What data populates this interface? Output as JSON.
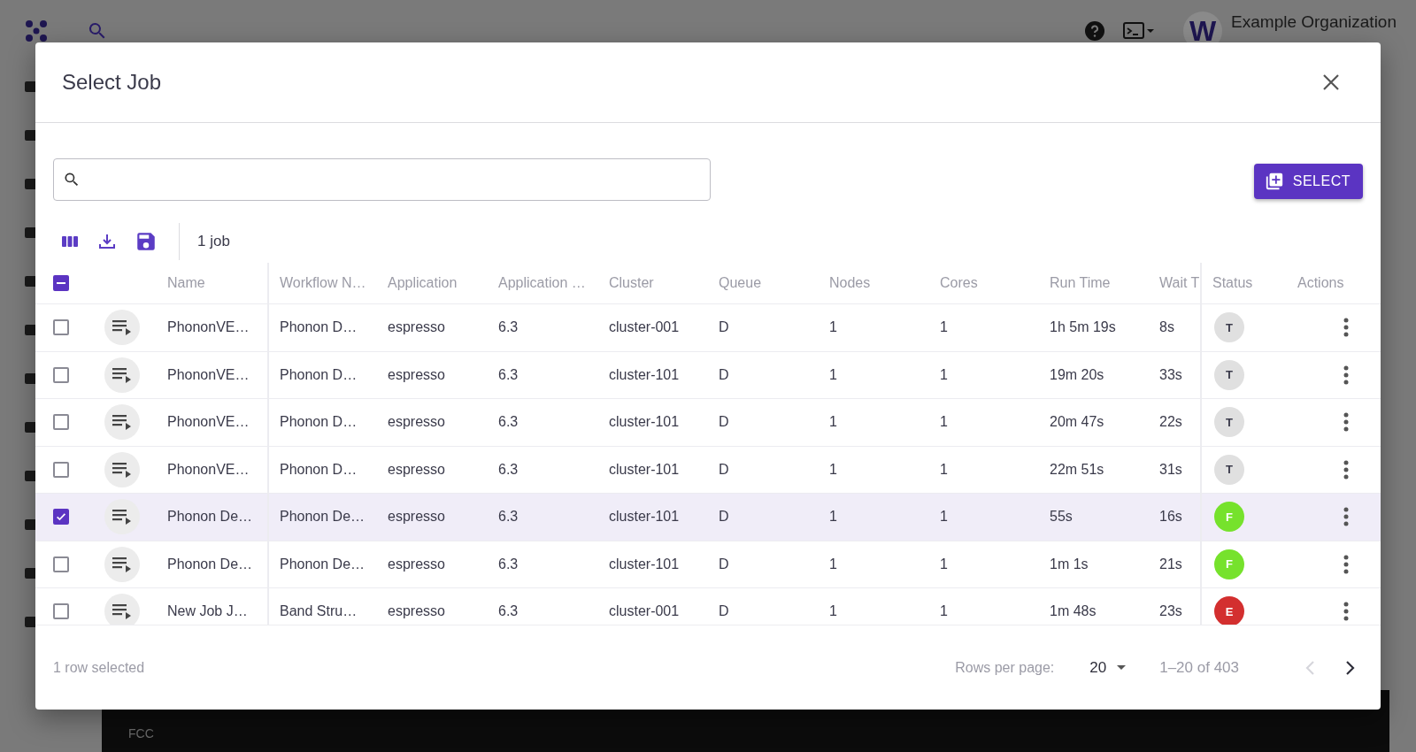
{
  "app": {
    "avatar_letter": "W",
    "org_name": "Example Organization",
    "panel_subtitle": "FCC"
  },
  "dialog": {
    "title": "Select Job",
    "select_button": "SELECT",
    "job_count": "1 job",
    "table": {
      "select_all": {
        "indeterminate": true
      },
      "columns": [
        "Name",
        "Workflow N…",
        "Application",
        "Application …",
        "Cluster",
        "Queue",
        "Nodes",
        "Cores",
        "Run Time",
        "Wait T",
        "Status",
        "Actions"
      ],
      "rows": [
        {
          "selected": false,
          "cells": [
            "PhononVE…",
            "Phonon D…",
            "espresso",
            "6.3",
            "cluster-001",
            "D",
            "1",
            "1",
            "1h 5m 19s",
            "8s"
          ],
          "status": {
            "label": "T",
            "color": "#e0e0e0"
          }
        },
        {
          "selected": false,
          "cells": [
            "PhononVE…",
            "Phonon D…",
            "espresso",
            "6.3",
            "cluster-101",
            "D",
            "1",
            "1",
            "19m 20s",
            "33s"
          ],
          "status": {
            "label": "T",
            "color": "#e0e0e0"
          }
        },
        {
          "selected": false,
          "cells": [
            "PhononVE…",
            "Phonon D…",
            "espresso",
            "6.3",
            "cluster-101",
            "D",
            "1",
            "1",
            "20m 47s",
            "22s"
          ],
          "status": {
            "label": "T",
            "color": "#e0e0e0"
          }
        },
        {
          "selected": false,
          "cells": [
            "PhononVE…",
            "Phonon D…",
            "espresso",
            "6.3",
            "cluster-101",
            "D",
            "1",
            "1",
            "22m 51s",
            "31s"
          ],
          "status": {
            "label": "T",
            "color": "#e0e0e0"
          }
        },
        {
          "selected": true,
          "cells": [
            "Phonon De…",
            "Phonon De…",
            "espresso",
            "6.3",
            "cluster-101",
            "D",
            "1",
            "1",
            "55s",
            "16s"
          ],
          "status": {
            "label": "F",
            "color": "#76e22c"
          }
        },
        {
          "selected": false,
          "cells": [
            "Phonon De…",
            "Phonon De…",
            "espresso",
            "6.3",
            "cluster-101",
            "D",
            "1",
            "1",
            "1m 1s",
            "21s"
          ],
          "status": {
            "label": "F",
            "color": "#76e22c"
          }
        },
        {
          "selected": false,
          "cells": [
            "New Job J…",
            "Band Stru…",
            "espresso",
            "6.3",
            "cluster-001",
            "D",
            "1",
            "1",
            "1m 48s",
            "23s"
          ],
          "status": {
            "label": "E",
            "color": "#d32f2f"
          }
        }
      ]
    },
    "footer": {
      "selection": "1 row selected",
      "rows_per_page_label": "Rows per page:",
      "rows_per_page": "20",
      "range": "1–20 of 403",
      "pager": [
        {
          "disabled": true
        },
        {
          "disabled": false
        }
      ]
    }
  }
}
